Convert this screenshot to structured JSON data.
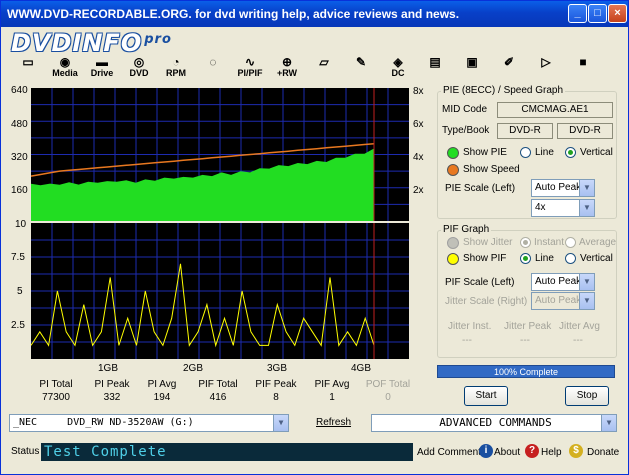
{
  "window": {
    "title": "WWW.DVD-RECORDABLE.ORG.  for dvd writing help, advice reviews and news."
  },
  "logo": {
    "main": "DVDINFO",
    "pro": "pro"
  },
  "toolbar": {
    "items": [
      {
        "name": "monitor",
        "label": ""
      },
      {
        "name": "media",
        "label": "Media"
      },
      {
        "name": "drive",
        "label": "Drive"
      },
      {
        "name": "dvd",
        "label": "DVD"
      },
      {
        "name": "rpm",
        "label": "RPM"
      },
      {
        "name": "scan",
        "label": ""
      },
      {
        "name": "pipif",
        "label": "PI/PIF"
      },
      {
        "name": "rw",
        "label": "+RW"
      },
      {
        "name": "erase",
        "label": ""
      },
      {
        "name": "burn",
        "label": ""
      },
      {
        "name": "dc",
        "label": "DC"
      },
      {
        "name": "notes",
        "label": ""
      },
      {
        "name": "camera",
        "label": ""
      },
      {
        "name": "edit",
        "label": ""
      },
      {
        "name": "play",
        "label": ""
      },
      {
        "name": "stop",
        "label": ""
      }
    ]
  },
  "chart_top": {
    "y_left_ticks": [
      "640",
      "480",
      "320",
      "160"
    ],
    "y_right_ticks": [
      "8x",
      "6x",
      "4x",
      "2x"
    ]
  },
  "chart_bottom": {
    "y_left_ticks": [
      "10",
      "7.5",
      "5",
      "2.5"
    ],
    "x_ticks": [
      "1GB",
      "2GB",
      "3GB",
      "4GB"
    ]
  },
  "chart_data": [
    {
      "type": "area",
      "series": [
        {
          "name": "PIE",
          "values": [
            175,
            178,
            176,
            180,
            182,
            181,
            185,
            190,
            188,
            195,
            192,
            190,
            196,
            200,
            205,
            210,
            208,
            215,
            218,
            222,
            230,
            228,
            235,
            240,
            250,
            258,
            265,
            270,
            275,
            280,
            285,
            290,
            300,
            310,
            320,
            330,
            345
          ]
        },
        {
          "name": "Speed",
          "values": [
            2.7,
            2.8,
            2.9,
            3.0,
            3.05,
            3.1,
            3.15,
            3.2,
            3.25,
            3.3,
            3.35,
            3.4,
            3.45,
            3.5,
            3.55,
            3.6,
            3.65,
            3.7,
            3.75,
            3.8,
            3.85,
            3.9,
            3.95,
            4.0,
            4.05,
            4.1,
            4.15,
            4.2,
            4.25,
            4.3,
            4.35,
            4.4,
            4.45,
            4.5,
            4.55,
            4.6,
            4.65
          ]
        }
      ],
      "ylim": [
        0,
        640
      ],
      "y2lim": [
        0,
        8
      ]
    },
    {
      "type": "line",
      "series": [
        {
          "name": "PIF",
          "values": [
            1,
            2,
            1,
            5,
            2,
            1,
            4,
            1,
            2,
            6,
            1,
            3,
            1,
            5,
            2,
            1,
            3,
            7,
            1,
            2,
            4,
            1,
            3,
            1,
            5,
            2,
            1,
            1,
            4,
            2,
            1,
            3,
            2,
            1,
            6,
            1,
            2,
            1,
            3,
            1
          ]
        }
      ],
      "ylim": [
        0,
        10
      ],
      "x": [
        "1GB",
        "2GB",
        "3GB",
        "4GB"
      ]
    }
  ],
  "stats": [
    {
      "label": "PI Total",
      "value": "77300",
      "dim": false
    },
    {
      "label": "PI Peak",
      "value": "332",
      "dim": false
    },
    {
      "label": "PI Avg",
      "value": "194",
      "dim": false
    },
    {
      "label": "PIF Total",
      "value": "416",
      "dim": false
    },
    {
      "label": "PIF Peak",
      "value": "8",
      "dim": false
    },
    {
      "label": "PIF Avg",
      "value": "1",
      "dim": false
    },
    {
      "label": "POF Total",
      "value": "0",
      "dim": true
    }
  ],
  "pie_panel": {
    "title": "PIE (8ECC) / Speed Graph",
    "mid_label": "MID Code",
    "mid_value": "CMCMAG.AE1",
    "type_label": "Type/Book",
    "type_value": "DVD-R",
    "book_value": "DVD-R",
    "show_pie": "Show PIE",
    "line": "Line",
    "vertical": "Vertical",
    "show_speed": "Show Speed",
    "scale_label": "PIE Scale (Left)",
    "scale_value": "Auto Peak",
    "speed_value": "4x",
    "pie_color": "#22dd22",
    "speed_color": "#e87820"
  },
  "pif_panel": {
    "title": "PIF Graph",
    "show_jitter": "Show Jitter",
    "instant": "Instant",
    "average": "Average",
    "show_pif": "Show PIF",
    "line": "Line",
    "vertical": "Vertical",
    "pif_scale_label": "PIF Scale (Left)",
    "pif_scale_value": "Auto Peak",
    "jitter_scale_label": "Jitter Scale (Right)",
    "jitter_scale_value": "Auto Peak",
    "jitter_inst": "Jitter Inst.",
    "jitter_peak": "Jitter Peak",
    "jitter_avg": "Jitter Avg",
    "jitter_inst_v": "---",
    "jitter_peak_v": "---",
    "jitter_avg_v": "---",
    "pif_color": "#ffff00"
  },
  "progress": {
    "text": "100% Complete",
    "value": 1.0
  },
  "buttons": {
    "start": "Start",
    "stop": "Stop"
  },
  "drive_select": {
    "value": "_NEC     DVD_RW ND-3520AW (G:)"
  },
  "refresh": "Refresh",
  "advanced": "ADVANCED COMMANDS",
  "status": {
    "label": "Status",
    "text": "Test Complete"
  },
  "footer": {
    "add_comment": "Add Comment",
    "about": "About",
    "help": "Help",
    "donate": "Donate"
  }
}
